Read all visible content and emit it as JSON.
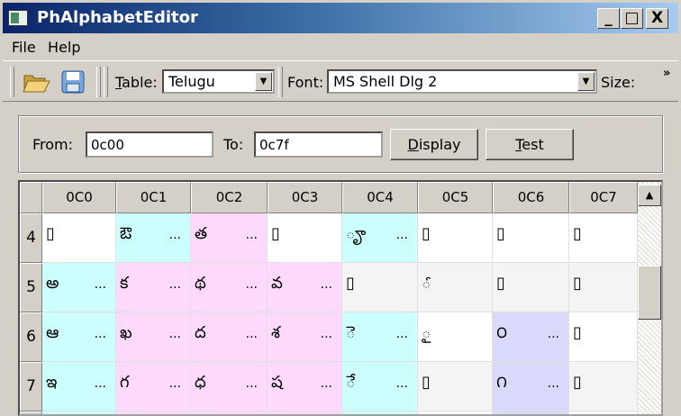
{
  "window": {
    "title": "PhAlphabetEditor",
    "minimize": "_",
    "maximize": "□",
    "close": "X"
  },
  "menu": [
    "File",
    "Help"
  ],
  "toolbar": {
    "table_label": "Table:",
    "table_value": "Telugu",
    "font_label": "Font:",
    "font_value": "MS Shell Dlg 2",
    "size_label": "Size:",
    "overflow": "»"
  },
  "range": {
    "from_label": "From:",
    "from_value": "0c00",
    "to_label": "To:",
    "to_value": "0c7f",
    "display_button": "Display",
    "test_button": "Test"
  },
  "colors": {
    "white": "#ffffff",
    "alt": "#f4f4f4",
    "cyan": "#ccfefe",
    "pink": "#fdd9fd",
    "lavender": "#d9d9fb"
  },
  "grid": {
    "columns": [
      "0C0",
      "0C1",
      "0C2",
      "0C3",
      "0C4",
      "0C5",
      "0C6",
      "0C7"
    ],
    "rows": [
      {
        "label": "4",
        "cells": [
          {
            "ch": "▯",
            "more": "",
            "bg": "white"
          },
          {
            "ch": "ఔ",
            "more": "...",
            "bg": "cyan"
          },
          {
            "ch": "త",
            "more": "...",
            "bg": "pink"
          },
          {
            "ch": "▯",
            "more": "",
            "bg": "white"
          },
          {
            "ch": "◌ౄ",
            "more": "...",
            "bg": "cyan"
          },
          {
            "ch": "▯",
            "more": "",
            "bg": "white"
          },
          {
            "ch": "▯",
            "more": "",
            "bg": "white"
          },
          {
            "ch": "▯",
            "more": "",
            "bg": "white"
          }
        ]
      },
      {
        "label": "5",
        "cells": [
          {
            "ch": "అ",
            "more": "...",
            "bg": "cyan"
          },
          {
            "ch": "క",
            "more": "...",
            "bg": "pink"
          },
          {
            "ch": "థ",
            "more": "...",
            "bg": "pink"
          },
          {
            "ch": "వ",
            "more": "...",
            "bg": "pink"
          },
          {
            "ch": "▯",
            "more": "",
            "bg": "alt"
          },
          {
            "ch": "◌ౕ",
            "more": "",
            "bg": "alt"
          },
          {
            "ch": "▯",
            "more": "",
            "bg": "alt"
          },
          {
            "ch": "▯",
            "more": "",
            "bg": "alt"
          }
        ]
      },
      {
        "label": "6",
        "cells": [
          {
            "ch": "ఆ",
            "more": "...",
            "bg": "cyan"
          },
          {
            "ch": "ఖ",
            "more": "...",
            "bg": "pink"
          },
          {
            "ch": "ద",
            "more": "...",
            "bg": "pink"
          },
          {
            "ch": "శ",
            "more": "...",
            "bg": "pink"
          },
          {
            "ch": "◌ె",
            "more": "...",
            "bg": "cyan"
          },
          {
            "ch": "◌ౖ",
            "more": "",
            "bg": "white"
          },
          {
            "ch": "౦",
            "more": "...",
            "bg": "lavender"
          },
          {
            "ch": "▯",
            "more": "",
            "bg": "white"
          }
        ]
      },
      {
        "label": "7",
        "cells": [
          {
            "ch": "ఇ",
            "more": "...",
            "bg": "cyan"
          },
          {
            "ch": "గ",
            "more": "...",
            "bg": "pink"
          },
          {
            "ch": "ధ",
            "more": "...",
            "bg": "pink"
          },
          {
            "ch": "ష",
            "more": "...",
            "bg": "pink"
          },
          {
            "ch": "◌ే",
            "more": "...",
            "bg": "cyan"
          },
          {
            "ch": "▯",
            "more": "",
            "bg": "alt"
          },
          {
            "ch": "౧",
            "more": "...",
            "bg": "lavender"
          },
          {
            "ch": "▯",
            "more": "",
            "bg": "alt"
          }
        ]
      }
    ],
    "partial_row_bg": [
      "cyan",
      "pink",
      "pink",
      "pink",
      "cyan",
      "white",
      "lavender",
      "white"
    ]
  }
}
